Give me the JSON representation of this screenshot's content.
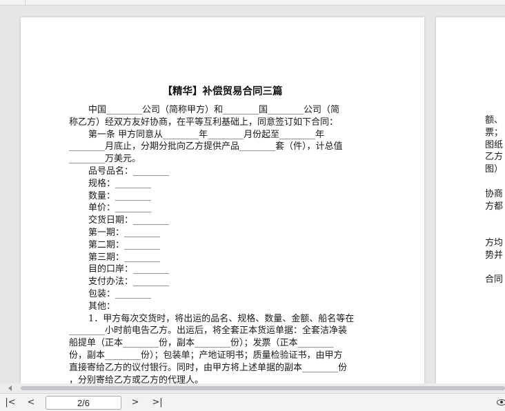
{
  "document": {
    "title": "【精华】补偿贸易合同三篇",
    "lines": [
      "中国________公司（简称甲方）和________国________公司（简",
      "称乙方）经双方友好协商，在平等互利基础上，同意签订如下合同：",
      "第一条 甲方同意从________年________月份起至________年",
      "________月底止，分期分批向乙方提供产品________套（件），计总值",
      "________万美元。",
      "品号品名：________",
      "规格：________",
      "数量：________",
      "单价：________",
      "交货日期：________",
      "第一期：________",
      "第二期：________",
      "第三期：________",
      "目的口岸：________",
      "支付办法：________",
      "包装：________",
      "其他：",
      "1．甲方每次交货时，将出运的品名、规格、数量、金额、船名等在",
      "________小时前电告乙方。出运后，将全套正本货运单据：全套洁净装",
      "船提单（正本________份，副本________份）；发票（正本________",
      "份，副本________份）；包装单；产地证明书；质量检验证书，由甲方",
      "直接寄给乙方的议付银行。同时，由甲方将上述单据的副本________份",
      "，分别寄给乙方或乙方的代理人。"
    ],
    "indented": [
      true,
      false,
      true,
      false,
      false,
      true,
      true,
      true,
      true,
      true,
      true,
      true,
      true,
      true,
      true,
      true,
      true,
      true,
      false,
      false,
      false,
      false,
      false
    ]
  },
  "next_page": {
    "lines": [
      "额、",
      "票；",
      "图纸",
      "乙方",
      "图）",
      "",
      "协商",
      "方都",
      "",
      "",
      "方均",
      "势并",
      "",
      "合同"
    ]
  },
  "toolbar": {
    "first_page_icon": "first-page-icon",
    "prev_page_icon": "prev-page-icon",
    "next_page_icon": "next-page-icon",
    "last_page_icon": "last-page-icon",
    "page_indicator": "2/6",
    "view_icon": "eye-icon"
  }
}
